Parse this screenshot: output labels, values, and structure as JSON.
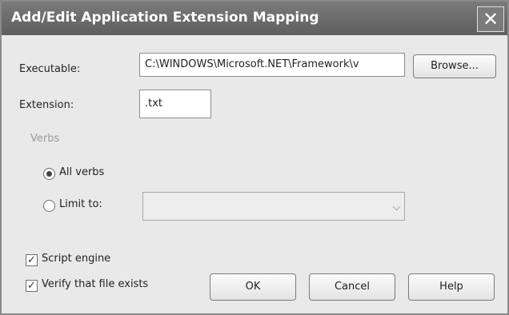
{
  "dialog": {
    "title": "Add/Edit Application Extension Mapping",
    "close_glyph": "✕"
  },
  "executable": {
    "label": "Executable:",
    "value": "C:\\WINDOWS\\Microsoft.NET\\Framework\\v",
    "browse_label": "Browse..."
  },
  "extension": {
    "label": "Extension:",
    "value": ".txt"
  },
  "verbs": {
    "group_label": "Verbs",
    "all_label": "All verbs",
    "limit_label": "Limit to:",
    "selected": "all",
    "limit_value": ""
  },
  "options": {
    "script_engine_label": "Script engine",
    "script_engine_checked": true,
    "verify_label": "Verify that file exists",
    "verify_checked": true
  },
  "buttons": {
    "ok": "OK",
    "cancel": "Cancel",
    "help": "Help"
  }
}
